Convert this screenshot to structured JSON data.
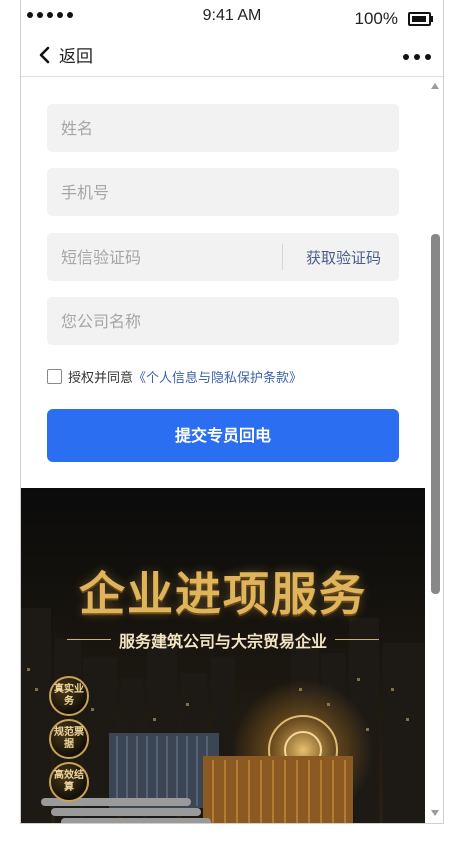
{
  "status_bar": {
    "time": "9:41 AM",
    "battery_text": "100%",
    "battery_level": 0.9
  },
  "nav": {
    "back_label": "返回",
    "back_icon": "chevron-left-icon",
    "more_icon": "more-horizontal-icon"
  },
  "form": {
    "name_placeholder": "姓名",
    "phone_placeholder": "手机号",
    "sms_placeholder": "短信验证码",
    "get_code_label": "获取验证码",
    "company_placeholder": "您公司名称",
    "agree_text": "授权并同意",
    "policy_link": "《个人信息与隐私保护条款》",
    "submit_label": "提交专员回电"
  },
  "banner": {
    "title": "企业进项服务",
    "subtitle": "服务建筑公司与大宗贸易企业",
    "badges": [
      "真实业务",
      "规范票据",
      "高效结算"
    ]
  },
  "colors": {
    "primary": "#2b6ef2",
    "link": "#3d62a8",
    "banner_gold": "#e0b45a"
  }
}
